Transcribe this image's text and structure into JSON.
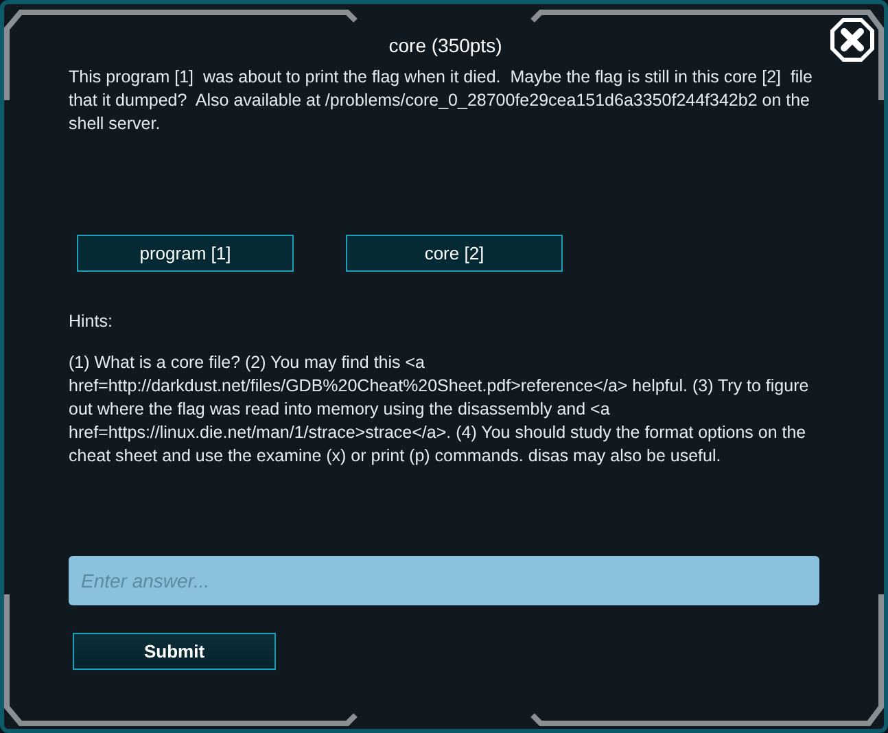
{
  "dialog": {
    "title": "core (350pts)",
    "description": "This program [1]  was about to print the flag when it died.  Maybe the flag is still in this core [2]  file that it dumped?  Also available at /problems/core_0_28700fe29cea151d6a3350f244f342b2 on the shell server.",
    "files": [
      "program [1]",
      "core [2]"
    ],
    "hints_label": "Hints:",
    "hints": "(1) What is a core file? (2) You may find this <a href=http://darkdust.net/files/GDB%20Cheat%20Sheet.pdf>reference</a> helpful. (3) Try to figure out where the flag was read into memory using the disassembly and <a href=https://linux.die.net/man/1/strace>strace</a>. (4) You should study the format options on the cheat sheet and use the examine (x) or print (p) commands. disas may also be useful.",
    "answer": {
      "placeholder": "Enter answer..."
    },
    "submit": "Submit"
  }
}
